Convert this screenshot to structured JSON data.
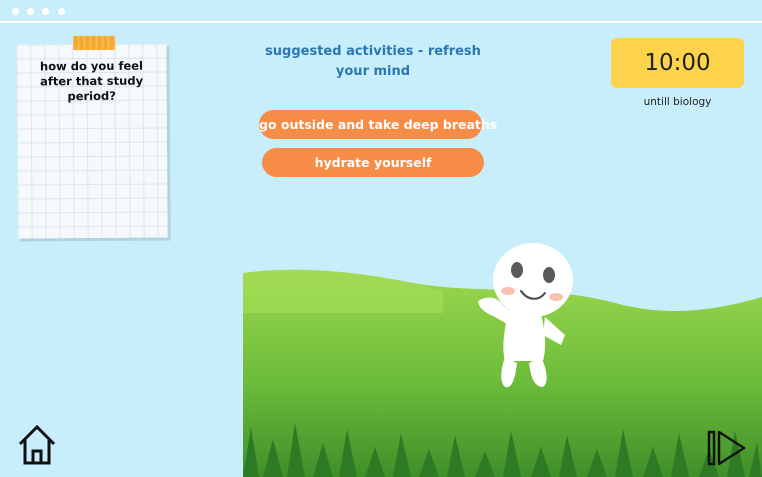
{
  "note": {
    "text": "how do you feel after that study period?"
  },
  "activities": {
    "title": "suggested activities - refresh your mind",
    "items": [
      "go outside and take deep breaths",
      "hydrate yourself"
    ]
  },
  "timer": {
    "value": "10:00",
    "caption": "untill biology"
  },
  "icons": {
    "home": "home-icon",
    "next": "skip-forward-icon",
    "character": "waving-character",
    "scene": "grass-field"
  },
  "colors": {
    "background": "#c9eefb",
    "button": "#f68c45",
    "timer": "#fcd34a",
    "title": "#2a78b3"
  }
}
